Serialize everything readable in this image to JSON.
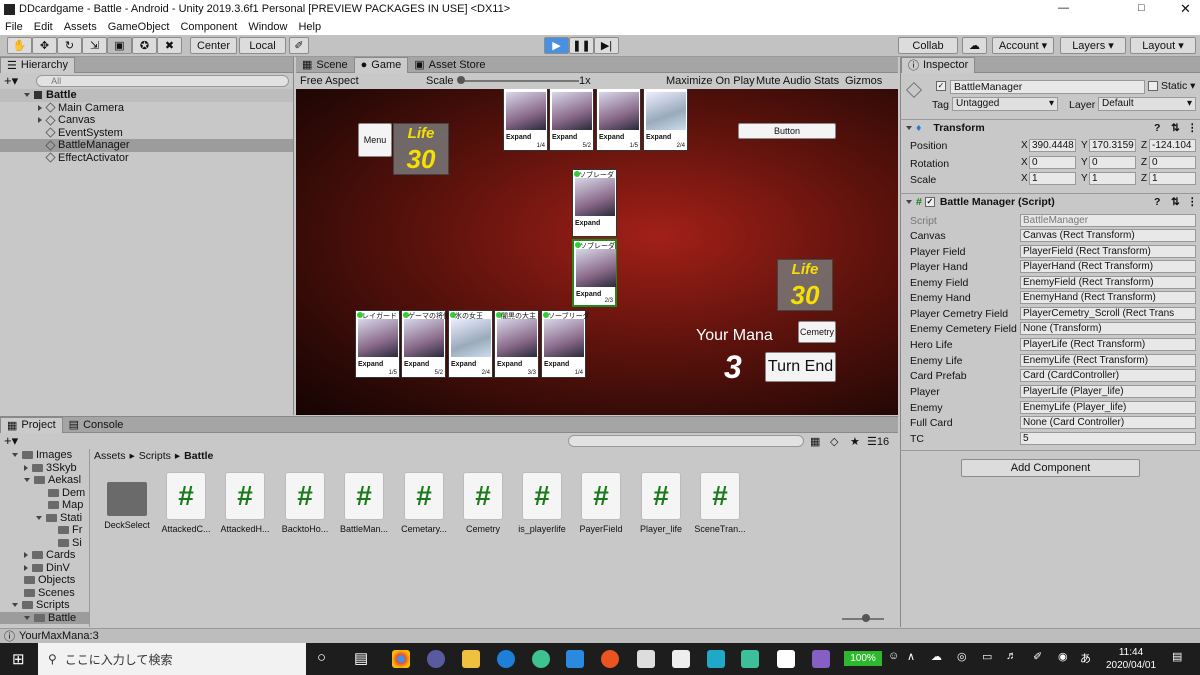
{
  "title": "DDcardgame - Battle - Android - Unity 2019.3.6f1 Personal [PREVIEW PACKAGES IN USE] <DX11>",
  "menu": [
    "File",
    "Edit",
    "Assets",
    "GameObject",
    "Component",
    "Window",
    "Help"
  ],
  "toolbar": {
    "center": "Center",
    "local": "Local",
    "collab": "Collab",
    "account": "Account",
    "layers": "Layers",
    "layout": "Layout"
  },
  "hierarchy": {
    "tab": "Hierarchy",
    "search": "All",
    "scene": "Battle",
    "items": [
      "Main Camera",
      "Canvas",
      "EventSystem",
      "BattleManager",
      "EffectActivator"
    ]
  },
  "gameview": {
    "tabs": [
      "Scene",
      "Game",
      "Asset Store"
    ],
    "aspect": "Free Aspect",
    "scale_label": "Scale",
    "scale_value": "1x",
    "toggles": [
      "Maximize On Play",
      "Mute Audio",
      "Stats",
      "Gizmos"
    ],
    "menu_btn": "Menu",
    "button_btn": "Button",
    "cemetry_btn": "Cemetry",
    "turnend_btn": "Turn End",
    "your_mana_label": "Your Mana",
    "mana": "3",
    "enemy_life_label": "Life",
    "enemy_life": "30",
    "player_life_label": "Life",
    "player_life": "30",
    "expand": "Expand",
    "enemy_cards": [
      {
        "stat": "1/4"
      },
      {
        "stat": "5/2"
      },
      {
        "stat": "1/5"
      },
      {
        "stat": "2/4"
      }
    ],
    "field_cards": [
      {
        "name": "ソブレーダ",
        "stat": ""
      },
      {
        "name": "ソブレーダ",
        "stat": "2/3"
      }
    ],
    "hand_cards": [
      {
        "name": "レイガード",
        "stat": "1/5"
      },
      {
        "name": "ゲーマの将傑",
        "stat": "5/2"
      },
      {
        "name": "氷の女王",
        "stat": "2/4"
      },
      {
        "name": "闇黒の大主",
        "stat": "3/3"
      },
      {
        "name": "ソーブリーダ",
        "stat": "1/4"
      }
    ]
  },
  "inspector": {
    "tab": "Inspector",
    "object": "BattleManager",
    "static": "Static",
    "tag_label": "Tag",
    "tag": "Untagged",
    "layer_label": "Layer",
    "layer": "Default",
    "transform": {
      "title": "Transform",
      "position": "Position",
      "rotation": "Rotation",
      "scale": "Scale",
      "px": "390.4448",
      "py": "170.3159",
      "pz": "-124.104",
      "rx": "0",
      "ry": "0",
      "rz": "0",
      "sx": "1",
      "sy": "1",
      "sz": "1"
    },
    "script_title": "Battle Manager (Script)",
    "fields": [
      {
        "label": "Script",
        "value": "BattleManager"
      },
      {
        "label": "Canvas",
        "value": "Canvas (Rect Transform)"
      },
      {
        "label": "Player Field",
        "value": "PlayerField (Rect Transform)"
      },
      {
        "label": "Player Hand",
        "value": "PlayerHand (Rect Transform)"
      },
      {
        "label": "Enemy Field",
        "value": "EnemyField (Rect Transform)"
      },
      {
        "label": "Enemy Hand",
        "value": "EnemyHand (Rect Transform)"
      },
      {
        "label": "Player Cemetry Field",
        "value": "PlayerCemetry_Scroll (Rect Trans"
      },
      {
        "label": "Enemy Cemetery Field",
        "value": "None (Transform)"
      },
      {
        "label": "Hero Life",
        "value": "PlayerLife (Rect Transform)"
      },
      {
        "label": "Enemy Life",
        "value": "EnemyLife (Rect Transform)"
      },
      {
        "label": "Card Prefab",
        "value": "Card (CardController)"
      },
      {
        "label": "Player",
        "value": "PlayerLife (Player_life)"
      },
      {
        "label": "Enemy",
        "value": "EnemyLife (Player_life)"
      },
      {
        "label": "Full Card",
        "value": "None (Card Controller)"
      },
      {
        "label": "TC",
        "value": "5"
      }
    ],
    "add_component": "Add Component"
  },
  "project": {
    "tabs": [
      "Project",
      "Console"
    ],
    "count": "16",
    "breadcrumb": [
      "Assets",
      "Scripts",
      "Battle"
    ],
    "tree": [
      "Images",
      "3Skyb",
      "Aekasl",
      "Dem",
      "Map",
      "Stati",
      "Fr",
      "Si",
      "Cards",
      "DinV",
      "Objects",
      "Scenes",
      "Scripts",
      "Battle"
    ],
    "assets": [
      "DeckSelect",
      "AttackedC...",
      "AttackedH...",
      "BacktoHo...",
      "BattleMan...",
      "Cemetary...",
      "Cemetry",
      "is_playerlife",
      "PayerField",
      "Player_life",
      "SceneTran..."
    ]
  },
  "status": "YourMaxMana:3",
  "taskbar": {
    "search": "ここに入力して検索",
    "battery": "100%",
    "time": "11:44",
    "date": "2020/04/01"
  }
}
